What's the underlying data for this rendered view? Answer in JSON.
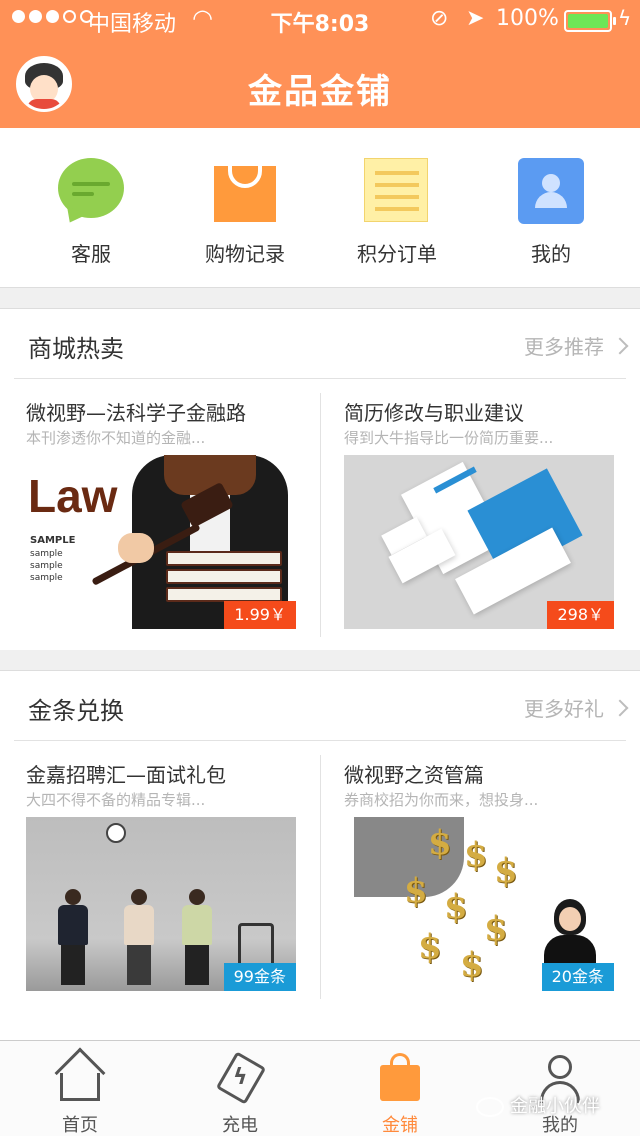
{
  "status_bar": {
    "carrier": "中国移动",
    "time": "下午8:03",
    "battery": "100%"
  },
  "header": {
    "title": "金品金铺"
  },
  "quick_menu": [
    {
      "label": "客服",
      "icon": "chat-bubble-icon"
    },
    {
      "label": "购物记录",
      "icon": "shopping-bag-icon"
    },
    {
      "label": "积分订单",
      "icon": "notepad-icon"
    },
    {
      "label": "我的",
      "icon": "user-profile-icon"
    }
  ],
  "sections": [
    {
      "title": "商城热卖",
      "more_label": "更多推荐",
      "cards": [
        {
          "title": "微视野—法科学子金融路",
          "subtitle": "本刊渗透你不知道的金融...",
          "price": "1.99￥",
          "image_text": "Law"
        },
        {
          "title": "简历修改与职业建议",
          "subtitle": "得到大牛指导比一份简历重要...",
          "price": "298￥"
        }
      ]
    },
    {
      "title": "金条兑换",
      "more_label": "更多好礼",
      "cards": [
        {
          "title": "金嘉招聘汇—面试礼包",
          "subtitle": "大四不得不备的精品专辑...",
          "price": "99金条"
        },
        {
          "title": "微视野之资管篇",
          "subtitle": "券商校招为你而来，想投身...",
          "price": "20金条"
        }
      ]
    }
  ],
  "tabs": [
    {
      "label": "首页",
      "icon": "home-icon"
    },
    {
      "label": "充电",
      "icon": "charge-tag-icon"
    },
    {
      "label": "金铺",
      "icon": "shop-bag-icon",
      "active": true
    },
    {
      "label": "我的",
      "icon": "person-icon"
    }
  ],
  "watermark": "金融小伙伴",
  "colors": {
    "header": "#ff9157",
    "accent": "#ff8a3c",
    "price_red": "#f54b1b",
    "price_blue": "#1a9bd7"
  }
}
